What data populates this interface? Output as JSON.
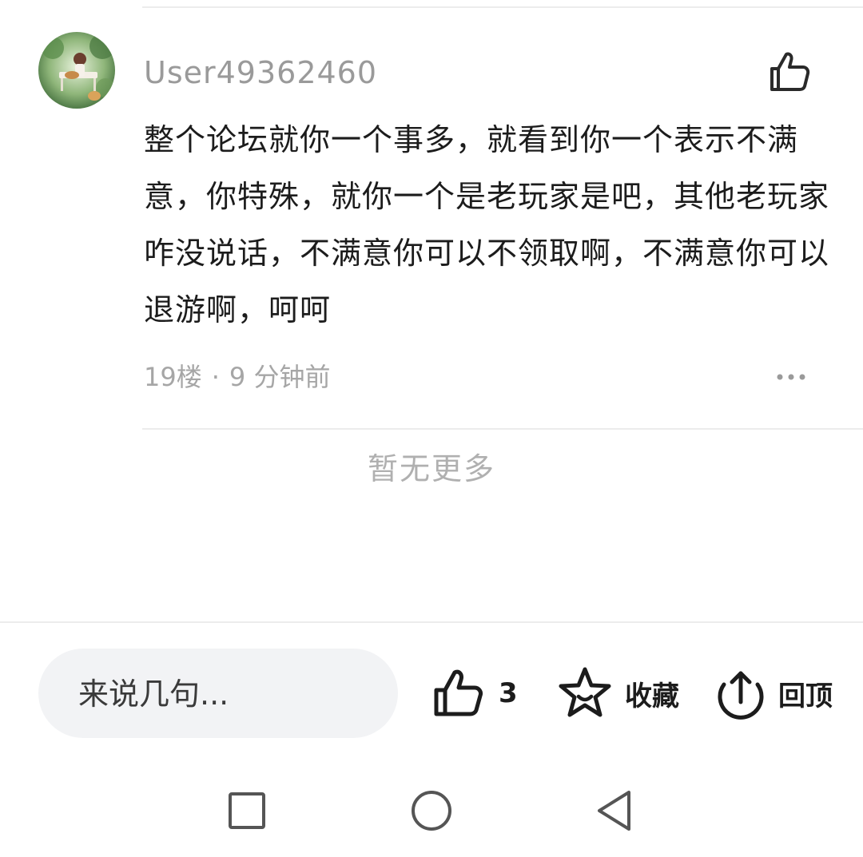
{
  "comment": {
    "username": "User49362460",
    "body": "整个论坛就你一个事多，就看到你一个表示不满意，你特殊，就你一个是老玩家是吧，其他老玩家咋没说话，不满意你可以不领取啊，不满意你可以退游啊，呵呵",
    "floor": "19楼",
    "separator": "·",
    "time": "9 分钟前"
  },
  "list_end_text": "暂无更多",
  "bottom_bar": {
    "input_placeholder": "来说几句...",
    "like_count": "3",
    "favorite_label": "收藏",
    "top_label": "回顶"
  },
  "icons": {
    "avatar": "avatar-image",
    "like_comment": "thumbs-up-icon",
    "more": "more-dots-icon",
    "like_post": "thumbs-up-icon",
    "favorite": "star-icon",
    "back_to_top": "upload-arrow-icon",
    "nav_recent": "square-icon",
    "nav_home": "circle-icon",
    "nav_back": "triangle-back-icon"
  },
  "colors": {
    "text_primary": "#1c1c1c",
    "text_secondary": "#9a9a9a",
    "input_bg": "#f2f3f5",
    "divider": "#ececec"
  }
}
